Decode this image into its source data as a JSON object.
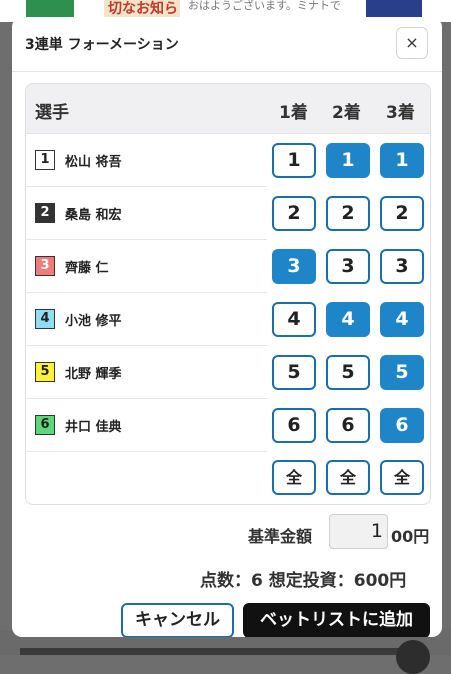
{
  "background": {
    "banner_text": "切なお知ら",
    "notice_text": "おはようございます。ミナトで"
  },
  "modal": {
    "title": "3連単 フォーメーション",
    "close_label": "×"
  },
  "table": {
    "headers": {
      "player": "選手",
      "c1": "1着",
      "c2": "2着",
      "c3": "3着"
    },
    "rows": [
      {
        "num": "1",
        "name": "松山 将吾",
        "box_color": "#ffffff",
        "box_text_color": "#222222",
        "c1": "1",
        "c2": "1",
        "c3": "1",
        "c1_selected": false,
        "c2_selected": true,
        "c3_selected": true
      },
      {
        "num": "2",
        "name": "桑島 和宏",
        "box_color": "#333333",
        "box_text_color": "#ffffff",
        "c1": "2",
        "c2": "2",
        "c3": "2",
        "c1_selected": false,
        "c2_selected": false,
        "c3_selected": false
      },
      {
        "num": "3",
        "name": "齊藤 仁",
        "box_color": "#f07b7b",
        "box_text_color": "#ffffff",
        "c1": "3",
        "c2": "3",
        "c3": "3",
        "c1_selected": true,
        "c2_selected": false,
        "c3_selected": false
      },
      {
        "num": "4",
        "name": "小池 修平",
        "box_color": "#8fdcf3",
        "box_text_color": "#222222",
        "c1": "4",
        "c2": "4",
        "c3": "4",
        "c1_selected": false,
        "c2_selected": true,
        "c3_selected": true
      },
      {
        "num": "5",
        "name": "北野 輝季",
        "box_color": "#fff13a",
        "box_text_color": "#222222",
        "c1": "5",
        "c2": "5",
        "c3": "5",
        "c1_selected": false,
        "c2_selected": false,
        "c3_selected": true
      },
      {
        "num": "6",
        "name": "井口 佳典",
        "box_color": "#5ed67a",
        "box_text_color": "#222222",
        "c1": "6",
        "c2": "6",
        "c3": "6",
        "c1_selected": false,
        "c2_selected": false,
        "c3_selected": true
      }
    ],
    "all_label": "全"
  },
  "amount": {
    "label": "基準金額",
    "value": "1",
    "unit": "00円"
  },
  "summary": {
    "text": "点数：6 想定投資：600円"
  },
  "buttons": {
    "cancel": "キャンセル",
    "add": "ベットリストに追加"
  },
  "colors": {
    "accent": "#1e86c8",
    "accent_border": "#1a6fa8"
  }
}
